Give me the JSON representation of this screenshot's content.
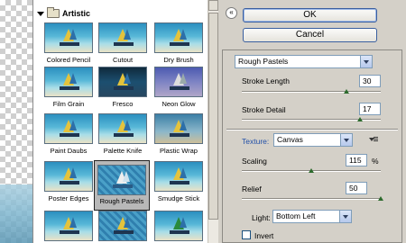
{
  "gallery": {
    "title": "Artistic",
    "items": [
      {
        "label": "Colored Pencil",
        "selected": false
      },
      {
        "label": "Cutout",
        "selected": false
      },
      {
        "label": "Dry Brush",
        "selected": false
      },
      {
        "label": "Film Grain",
        "selected": false
      },
      {
        "label": "Fresco",
        "selected": false
      },
      {
        "label": "Neon Glow",
        "selected": false
      },
      {
        "label": "Paint Daubs",
        "selected": false
      },
      {
        "label": "Palette Knife",
        "selected": false
      },
      {
        "label": "Plastic Wrap",
        "selected": false
      },
      {
        "label": "Poster Edges",
        "selected": false
      },
      {
        "label": "Rough Pastels",
        "selected": true
      },
      {
        "label": "Smudge Stick",
        "selected": false
      }
    ]
  },
  "dialog": {
    "ok_label": "OK",
    "cancel_label": "Cancel",
    "filter_select": "Rough Pastels",
    "stroke_length": {
      "label": "Stroke Length",
      "value": "30",
      "slider_fraction": 0.75
    },
    "stroke_detail": {
      "label": "Stroke Detail",
      "value": "17",
      "slider_fraction": 0.85
    },
    "texture": {
      "label": "Texture:",
      "value": "Canvas"
    },
    "scaling": {
      "label": "Scaling",
      "value": "115",
      "unit": "%",
      "slider_fraction": 0.5
    },
    "relief": {
      "label": "Relief",
      "value": "50",
      "slider_fraction": 1.0
    },
    "light": {
      "label": "Light:",
      "value": "Bottom Left"
    },
    "invert": {
      "label": "Invert",
      "checked": false
    }
  },
  "colors": {
    "accent": "#3a5f9f",
    "link": "#2250a8",
    "slider_knob": "#2c6a2c"
  }
}
